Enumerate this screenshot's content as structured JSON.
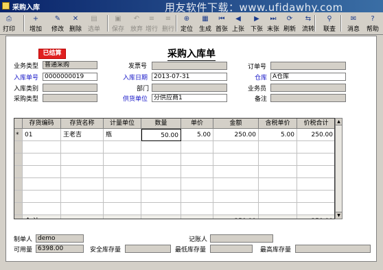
{
  "window": {
    "title": "采购入库"
  },
  "watermark": "用友软件下载：www.ufidawhy.com",
  "toolbar": [
    {
      "label": "打印",
      "icon": "printer-icon",
      "glyph": "⎙",
      "disabled": false
    },
    {
      "label": "增加",
      "icon": "add-icon",
      "glyph": "+",
      "disabled": false
    },
    {
      "label": "修改",
      "icon": "edit-icon",
      "glyph": "✎",
      "disabled": false
    },
    {
      "label": "删除",
      "icon": "delete-icon",
      "glyph": "✕",
      "disabled": false
    },
    {
      "label": "选单",
      "icon": "select-icon",
      "glyph": "▤",
      "disabled": true
    },
    {
      "label": "保存",
      "icon": "save-icon",
      "glyph": "▣",
      "disabled": true
    },
    {
      "label": "放弃",
      "icon": "discard-icon",
      "glyph": "↶",
      "disabled": true
    },
    {
      "label": "增行",
      "icon": "add-row-icon",
      "glyph": "≡",
      "disabled": true
    },
    {
      "label": "删行",
      "icon": "delete-row-icon",
      "glyph": "≡",
      "disabled": true
    },
    {
      "label": "定位",
      "icon": "locate-icon",
      "glyph": "⊕",
      "disabled": false
    },
    {
      "label": "生成",
      "icon": "generate-icon",
      "glyph": "▦",
      "disabled": false
    },
    {
      "label": "首张",
      "icon": "first-icon",
      "glyph": "⏮",
      "disabled": false
    },
    {
      "label": "上张",
      "icon": "prev-icon",
      "glyph": "◀",
      "disabled": false
    },
    {
      "label": "下张",
      "icon": "next-icon",
      "glyph": "▶",
      "disabled": false
    },
    {
      "label": "末张",
      "icon": "last-icon",
      "glyph": "⏭",
      "disabled": false
    },
    {
      "label": "刷新",
      "icon": "refresh-icon",
      "glyph": "⟳",
      "disabled": false
    },
    {
      "label": "流转",
      "icon": "flow-icon",
      "glyph": "⇆",
      "disabled": false
    },
    {
      "label": "联查",
      "icon": "query-icon",
      "glyph": "⚲",
      "disabled": false
    },
    {
      "label": "消息",
      "icon": "message-icon",
      "glyph": "✉",
      "disabled": false
    },
    {
      "label": "帮助",
      "icon": "help-icon",
      "glyph": "?",
      "disabled": false
    }
  ],
  "form": {
    "title": "采购入库单",
    "stamp": "已结算",
    "labels": {
      "business_type": "业务类型",
      "receipt_no": "入库单号",
      "receipt_category": "入库类别",
      "purchase_type": "采购类型",
      "invoice_no": "发票号",
      "receipt_date": "入库日期",
      "department": "部门",
      "supplier": "供货单位",
      "order_no": "订单号",
      "warehouse": "仓库",
      "salesman": "业务员",
      "remark": "备注"
    },
    "values": {
      "business_type": "普通采购",
      "receipt_no": "0000000019",
      "receipt_category": "",
      "purchase_type": "",
      "invoice_no": "",
      "receipt_date": "2013-07-31",
      "department": "",
      "supplier": "分供应商1",
      "order_no": "",
      "warehouse": "A仓库",
      "salesman": "",
      "remark": ""
    }
  },
  "grid": {
    "columns": [
      "存货编码",
      "存货名称",
      "计量单位",
      "数量",
      "单价",
      "金额",
      "含税单价",
      "价税合计"
    ],
    "rows": [
      {
        "marker": "*",
        "code": "01",
        "name": "王老吉",
        "unit": "瓶",
        "qty": "50.00",
        "price": "5.00",
        "amount": "250.00",
        "tax_price": "5.00",
        "total": "250.00"
      }
    ],
    "total_row": {
      "label": "合  计",
      "amount": "250.00",
      "total": "250.00"
    }
  },
  "footer": {
    "maker_label": "制单人",
    "maker_value": "demo",
    "bookkeeper_label": "记账人",
    "bookkeeper_value": "",
    "available_label": "可用量",
    "available_value": "6398.00",
    "safety_label": "安全库存量",
    "safety_value": "",
    "min_label": "最低库存量",
    "min_value": "",
    "max_label": "最高库存量",
    "max_value": ""
  }
}
